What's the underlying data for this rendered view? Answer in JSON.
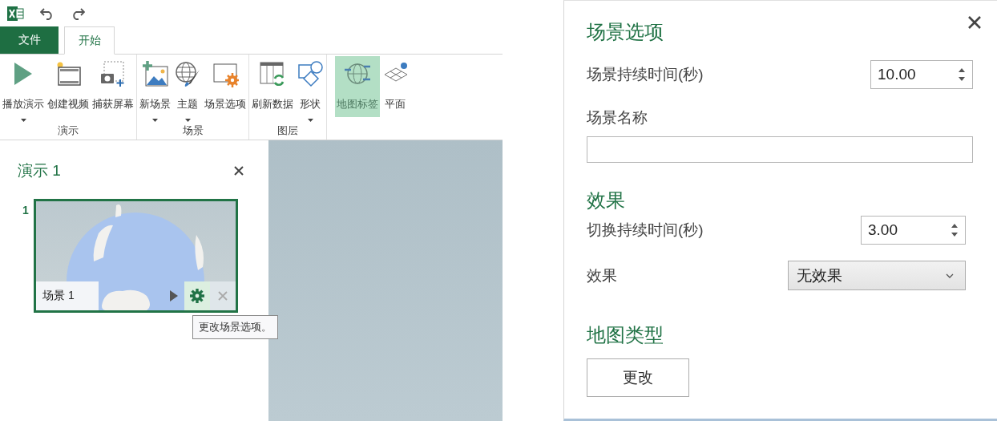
{
  "tabs": [
    {
      "label": "文件",
      "kind": "file",
      "selected": false
    },
    {
      "label": "开始",
      "kind": "normal",
      "selected": true
    }
  ],
  "ribbon_groups": [
    {
      "label": "演示",
      "buttons": [
        {
          "label": "播放演示",
          "kind": "play",
          "dropdown": true,
          "on": false
        },
        {
          "label": "创建视频",
          "kind": "film",
          "dropdown": false,
          "on": false
        },
        {
          "label": "捕获屏幕",
          "kind": "camera",
          "dropdown": false,
          "on": false
        }
      ]
    },
    {
      "label": "场景",
      "buttons": [
        {
          "label": "新场景",
          "kind": "new-scene",
          "dropdown": true,
          "on": false
        },
        {
          "label": "主题",
          "kind": "theme",
          "dropdown": true,
          "on": false
        },
        {
          "label": "场景选项",
          "kind": "scene-options",
          "dropdown": false,
          "on": false
        }
      ]
    },
    {
      "label": "图层",
      "buttons": [
        {
          "label": "刷新数据",
          "kind": "refresh",
          "dropdown": false,
          "on": false
        },
        {
          "label": "形状",
          "kind": "shapes",
          "dropdown": true,
          "on": false
        }
      ]
    },
    {
      "buttons": [
        {
          "label": "地图标签",
          "kind": "map-labels",
          "dropdown": false,
          "on": true
        },
        {
          "label": "平面",
          "kind": "flat-map",
          "dropdown": false,
          "on": false
        }
      ]
    }
  ],
  "tour": {
    "title": "演示 1",
    "scenes": [
      {
        "number": "1",
        "name": "场景 1",
        "selected": true
      }
    ]
  },
  "tooltip": "更改场景选项。",
  "scene_options": {
    "title": "场景选项",
    "duration_label": "场景持续时间(秒)",
    "duration_value": "10.00",
    "name_label": "场景名称",
    "effects_title": "效果",
    "transition_label": "切换持续时间(秒)",
    "transition_value": "3.00",
    "effect_label": "效果",
    "effect_value": "无效果",
    "map_type_title": "地图类型",
    "change_button": "更改"
  }
}
